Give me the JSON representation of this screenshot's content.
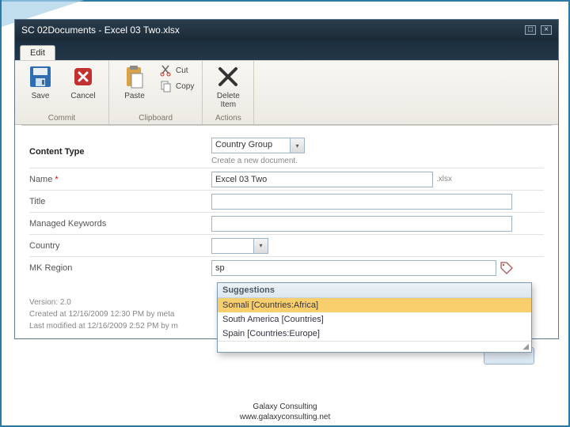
{
  "window": {
    "title": "SC 02Documents - Excel 03 Two.xlsx"
  },
  "ribbon": {
    "tab": "Edit",
    "groups": {
      "commit": {
        "title": "Commit",
        "save": "Save",
        "cancel": "Cancel"
      },
      "clipboard": {
        "title": "Clipboard",
        "paste": "Paste",
        "cut": "Cut",
        "copy": "Copy"
      },
      "actions": {
        "title": "Actions",
        "delete": "Delete\nItem"
      }
    }
  },
  "form": {
    "content_type": {
      "label": "Content Type",
      "value": "Country Group",
      "helper": "Create a new document."
    },
    "name": {
      "label": "Name",
      "required": "*",
      "value": "Excel 03 Two",
      "ext": ".xlsx"
    },
    "title": {
      "label": "Title",
      "value": ""
    },
    "managed_keywords": {
      "label": "Managed Keywords",
      "value": ""
    },
    "country": {
      "label": "Country",
      "value": ""
    },
    "mk_region": {
      "label": "MK Region",
      "value": "sp"
    }
  },
  "suggestions": {
    "header": "Suggestions",
    "items": [
      "Somali  [Countries:Africa]",
      "South America  [Countries]",
      "Spain  [Countries:Europe]"
    ]
  },
  "meta": {
    "version": "Version: 2.0",
    "created": "Created at 12/16/2009 12:30 PM by meta",
    "modified": "Last modified at 12/16/2009 2:52 PM by m"
  },
  "footer": {
    "line1": "Galaxy Consulting",
    "line2": "www.galaxyconsulting.net"
  }
}
